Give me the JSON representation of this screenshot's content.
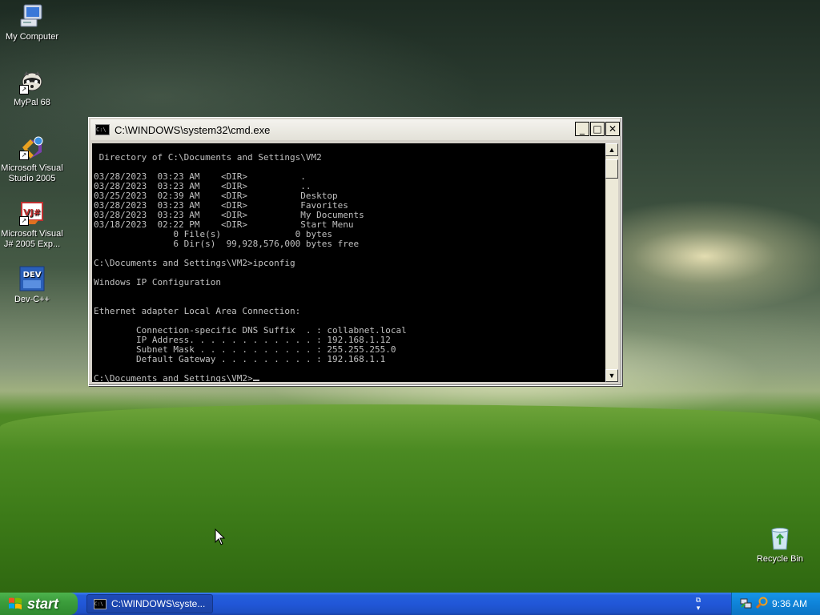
{
  "desktop": {
    "icons": [
      {
        "label": "My Computer"
      },
      {
        "label": "MyPal 68"
      },
      {
        "label": "Microsoft Visual Studio 2005"
      },
      {
        "label": "Microsoft Visual J# 2005 Exp..."
      },
      {
        "label": "Dev-C++"
      },
      {
        "label": "Recycle Bin"
      }
    ]
  },
  "cmd_window": {
    "title": "C:\\WINDOWS\\system32\\cmd.exe",
    "lines": [
      "",
      " Directory of C:\\Documents and Settings\\VM2",
      "",
      "03/28/2023  03:23 AM    <DIR>          .",
      "03/28/2023  03:23 AM    <DIR>          ..",
      "03/25/2023  02:39 AM    <DIR>          Desktop",
      "03/28/2023  03:23 AM    <DIR>          Favorites",
      "03/28/2023  03:23 AM    <DIR>          My Documents",
      "03/18/2023  02:22 PM    <DIR>          Start Menu",
      "               0 File(s)              0 bytes",
      "               6 Dir(s)  99,928,576,000 bytes free",
      "",
      "C:\\Documents and Settings\\VM2>ipconfig",
      "",
      "Windows IP Configuration",
      "",
      "",
      "Ethernet adapter Local Area Connection:",
      "",
      "        Connection-specific DNS Suffix  . : collabnet.local",
      "        IP Address. . . . . . . . . . . . : 192.168.1.12",
      "        Subnet Mask . . . . . . . . . . . : 255.255.255.0",
      "        Default Gateway . . . . . . . . . : 192.168.1.1",
      ""
    ],
    "prompt": "C:\\Documents and Settings\\VM2>",
    "buttons": {
      "minimize": "_",
      "maximize": "□",
      "close": "✕"
    }
  },
  "taskbar": {
    "start_label": "start",
    "task_label": "C:\\WINDOWS\\syste...",
    "clock": "9:36 AM"
  },
  "colors": {
    "console_bg": "#000000",
    "console_fg": "#c0c0c0",
    "taskbar_blue": "#245edb",
    "start_green": "#3c9e3c",
    "tray_blue": "#0f83d8"
  }
}
